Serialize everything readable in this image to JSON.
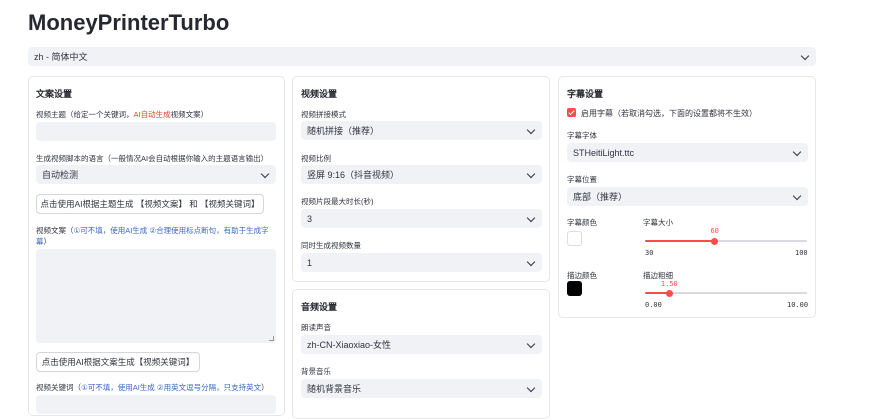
{
  "app": {
    "title": "MoneyPrinterTurbo"
  },
  "language_select": {
    "value": "zh - 简体中文"
  },
  "script_panel": {
    "title": "文案设置",
    "subject_label_prefix": "视频主题（给定一个关键词，",
    "subject_label_highlight": "AI自动生成",
    "subject_label_suffix": "视频文案）",
    "subject_value": "",
    "language_label": "生成视频脚本的语言（一般情况AI会自动根据你输入的主题语言输出）",
    "language_value": "自动检测",
    "generate_script_button": "点击使用AI根据主题生成 【视频文案】 和 【视频关键词】",
    "script_label": "视频文案（",
    "script_hint": "①可不填，使用AI生成 ②合理使用标点断句，有助于生成字幕",
    "script_label_end": "）",
    "script_value": "",
    "generate_terms_button": "点击使用AI根据文案生成【视频关键词】",
    "terms_label": "视频关键词（",
    "terms_hint": "①可不填，使用AI生成 ②用英文逗号分隔，只支持英文",
    "terms_label_end": "）"
  },
  "video_panel": {
    "title": "视频设置",
    "concat_label": "视频拼接模式",
    "concat_value": "随机拼接（推荐）",
    "aspect_label": "视频比例",
    "aspect_value": "竖屏 9:16（抖音视频）",
    "clip_label": "视频片段最大时长(秒)",
    "clip_value": "3",
    "count_label": "同时生成视频数量",
    "count_value": "1"
  },
  "audio_panel": {
    "title": "音频设置",
    "voice_label": "朗读声音",
    "voice_value": "zh-CN-XiaoxiaoNeural-女性",
    "voice_display": "zh-CN-Xiaoxiao-女性",
    "bgm_label": "背景音乐",
    "bgm_value": "随机背景音乐"
  },
  "subtitle_panel": {
    "title": "字幕设置",
    "enable_label": "启用字幕（若取消勾选，下面的设置都将不生效）",
    "enabled": true,
    "font_label": "字幕字体",
    "font_value": "STHeitiLight.ttc",
    "position_label": "字幕位置",
    "position_value": "底部（推荐）",
    "font_color_label": "字幕颜色",
    "font_color": "#ffffff",
    "font_size_label": "字幕大小",
    "font_size_value": "60",
    "font_size_min": "30",
    "font_size_max": "100",
    "font_size_fraction": 0.43,
    "stroke_color_label": "描边颜色",
    "stroke_color": "#000000",
    "stroke_width_label": "描边粗细",
    "stroke_width_value": "1.50",
    "stroke_width_min": "0.00",
    "stroke_width_max": "10.00",
    "stroke_width_fraction": 0.15
  },
  "colors": {
    "accent": "#ff4b4b",
    "input_bg": "#f0f2f6",
    "hint_blue": "#3c67c1",
    "hint_red": "#e0452e"
  }
}
